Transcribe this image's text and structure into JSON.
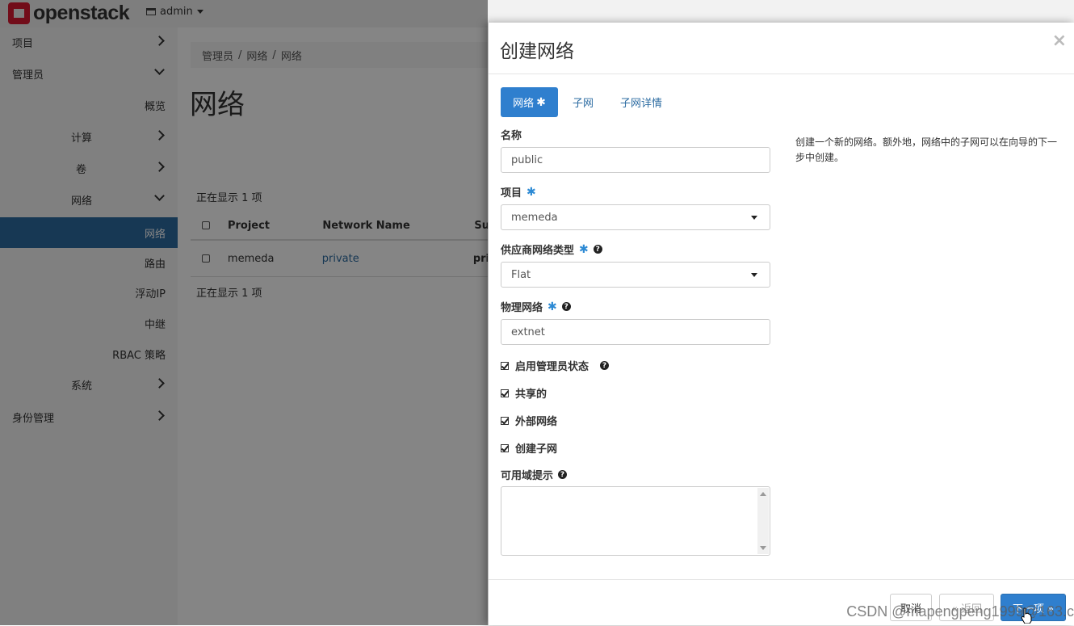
{
  "topbar": {
    "logo_text": "openstack",
    "project_switch": "admin"
  },
  "sidebar": {
    "items": [
      {
        "label": "项目",
        "chevron": "right"
      },
      {
        "label": "管理员",
        "chevron": "down"
      },
      {
        "label": "概览",
        "chevron": ""
      },
      {
        "label": "计算",
        "chevron": "right"
      },
      {
        "label": "卷",
        "chevron": "right"
      },
      {
        "label": "网络",
        "chevron": "down"
      },
      {
        "label": "网络",
        "chevron": "",
        "active": true
      },
      {
        "label": "路由",
        "chevron": ""
      },
      {
        "label": "浮动IP",
        "chevron": ""
      },
      {
        "label": "中继",
        "chevron": ""
      },
      {
        "label": "RBAC 策略",
        "chevron": ""
      },
      {
        "label": "系统",
        "chevron": "right"
      },
      {
        "label": "身份管理",
        "chevron": "right"
      }
    ]
  },
  "main": {
    "breadcrumb": [
      "管理员",
      "/",
      "网络",
      "/",
      "网络"
    ],
    "title": "网络",
    "count_top": "正在显示 1 项",
    "count_bottom": "正在显示 1 项",
    "table": {
      "columns": [
        "Project",
        "Network Name",
        "Su"
      ],
      "rows": [
        {
          "project": "memeda",
          "name": "private",
          "subnet": "pri"
        }
      ]
    }
  },
  "modal": {
    "title": "创建网络",
    "close": "×",
    "tabs": [
      {
        "label": "网络",
        "required": "✱"
      },
      {
        "label": "子网"
      },
      {
        "label": "子网详情"
      }
    ],
    "fields": {
      "name": {
        "label": "名称",
        "value": "public"
      },
      "project": {
        "label": "项目",
        "required": "✱",
        "value": "memeda"
      },
      "provider_type": {
        "label": "供应商网络类型",
        "required": "✱",
        "help": "?",
        "value": "Flat"
      },
      "physical_network": {
        "label": "物理网络",
        "required": "✱",
        "help": "?",
        "value": "extnet"
      },
      "admin_state": {
        "label": "启用管理员状态",
        "help": "?",
        "checked": true
      },
      "shared": {
        "label": "共享的",
        "checked": true
      },
      "external": {
        "label": "外部网络",
        "checked": true
      },
      "create_subnet": {
        "label": "创建子网",
        "checked": true
      },
      "az_hints": {
        "label": "可用域提示",
        "help": "?"
      }
    },
    "help_text": "创建一个新的网络。额外地，网络中的子网可以在向导的下一步中创建。",
    "footer": {
      "cancel": "取消",
      "back": "« 返回",
      "next": "下一项 »"
    }
  },
  "watermark": "CSDN @mapengpeng1999@163.c"
}
